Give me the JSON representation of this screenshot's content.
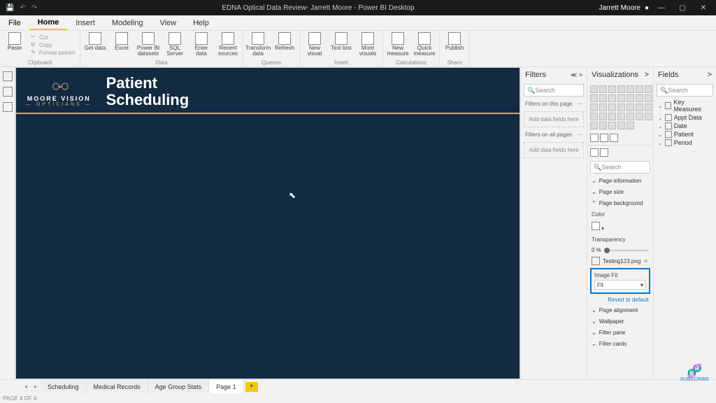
{
  "titlebar": {
    "title": "EDNA Optical Data Review- Jarrett Moore - Power BI Desktop",
    "user": "Jarrett Moore"
  },
  "menu": {
    "file": "File",
    "home": "Home",
    "insert": "Insert",
    "modeling": "Modeling",
    "view": "View",
    "help": "Help"
  },
  "ribbon": {
    "clipboard": {
      "label": "Clipboard",
      "paste": "Paste",
      "cut": "Cut",
      "copy": "Copy",
      "format_painter": "Format painter"
    },
    "data": {
      "label": "Data",
      "get_data": "Get data",
      "excel": "Excel",
      "pbi_datasets": "Power BI datasets",
      "sql": "SQL Server",
      "enter": "Enter data",
      "recent": "Recent sources"
    },
    "queries": {
      "label": "Queries",
      "transform": "Transform data",
      "refresh": "Refresh"
    },
    "insert": {
      "label": "Insert",
      "new_visual": "New visual",
      "text_box": "Text box",
      "more": "More visuals"
    },
    "calc": {
      "label": "Calculations",
      "new_measure": "New measure",
      "quick_measure": "Quick measure"
    },
    "share": {
      "label": "Share",
      "publish": "Publish"
    }
  },
  "canvas": {
    "logo_name": "MOORE VISION",
    "logo_sub": "— OPTICIANS —",
    "title_line1": "Patient",
    "title_line2": "Scheduling"
  },
  "filters": {
    "header": "Filters",
    "search": "Search",
    "on_page": "Filters on this page",
    "on_all": "Filters on all pages",
    "add_here": "Add data fields here"
  },
  "viz": {
    "header": "Visualizations",
    "search": "Search",
    "sections": {
      "page_info": "Page information",
      "page_size": "Page size",
      "page_bg": "Page background",
      "color": "Color",
      "transparency": "Transparency",
      "transparency_val": "0  %",
      "image_name": "Testing123.png",
      "image_fit_label": "Image Fit",
      "image_fit_val": "Fit",
      "revert": "Revert to default",
      "page_align": "Page alignment",
      "wallpaper": "Wallpaper",
      "filter_pane": "Filter pane",
      "filter_cards": "Filter cards"
    }
  },
  "fields": {
    "header": "Fields",
    "search": "Search",
    "tables": [
      "Key Measures",
      "Appt Data",
      "Date",
      "Patient",
      "Period"
    ]
  },
  "tabs": {
    "pages": [
      "Scheduling",
      "Medical Records",
      "Age Group Stats",
      "Page 1"
    ]
  },
  "status": "PAGE 4 OF 4",
  "subscribe": "SUBSCRIBE"
}
